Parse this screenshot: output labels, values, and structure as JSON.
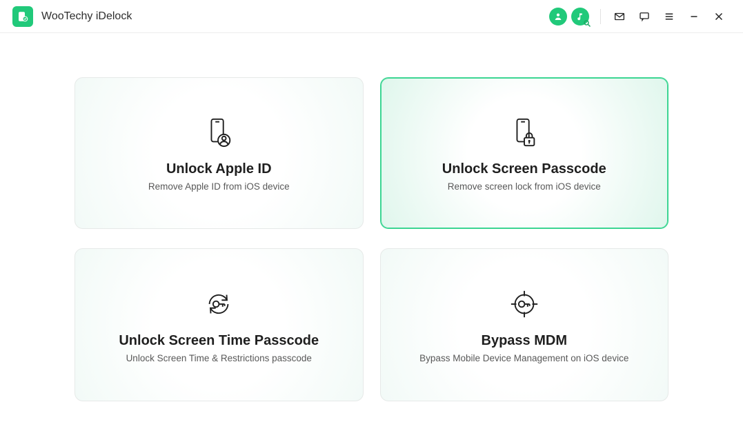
{
  "app": {
    "title": "WooTechy iDelock"
  },
  "cards": {
    "apple_id": {
      "title": "Unlock Apple ID",
      "subtitle": "Remove Apple ID from iOS device"
    },
    "screen_passcode": {
      "title": "Unlock Screen Passcode",
      "subtitle": "Remove screen lock from iOS device"
    },
    "screen_time": {
      "title": "Unlock Screen Time Passcode",
      "subtitle": "Unlock Screen Time & Restrictions passcode"
    },
    "mdm": {
      "title": "Bypass MDM",
      "subtitle": "Bypass Mobile Device Management on iOS device"
    }
  },
  "colors": {
    "accent": "#21c97a"
  }
}
